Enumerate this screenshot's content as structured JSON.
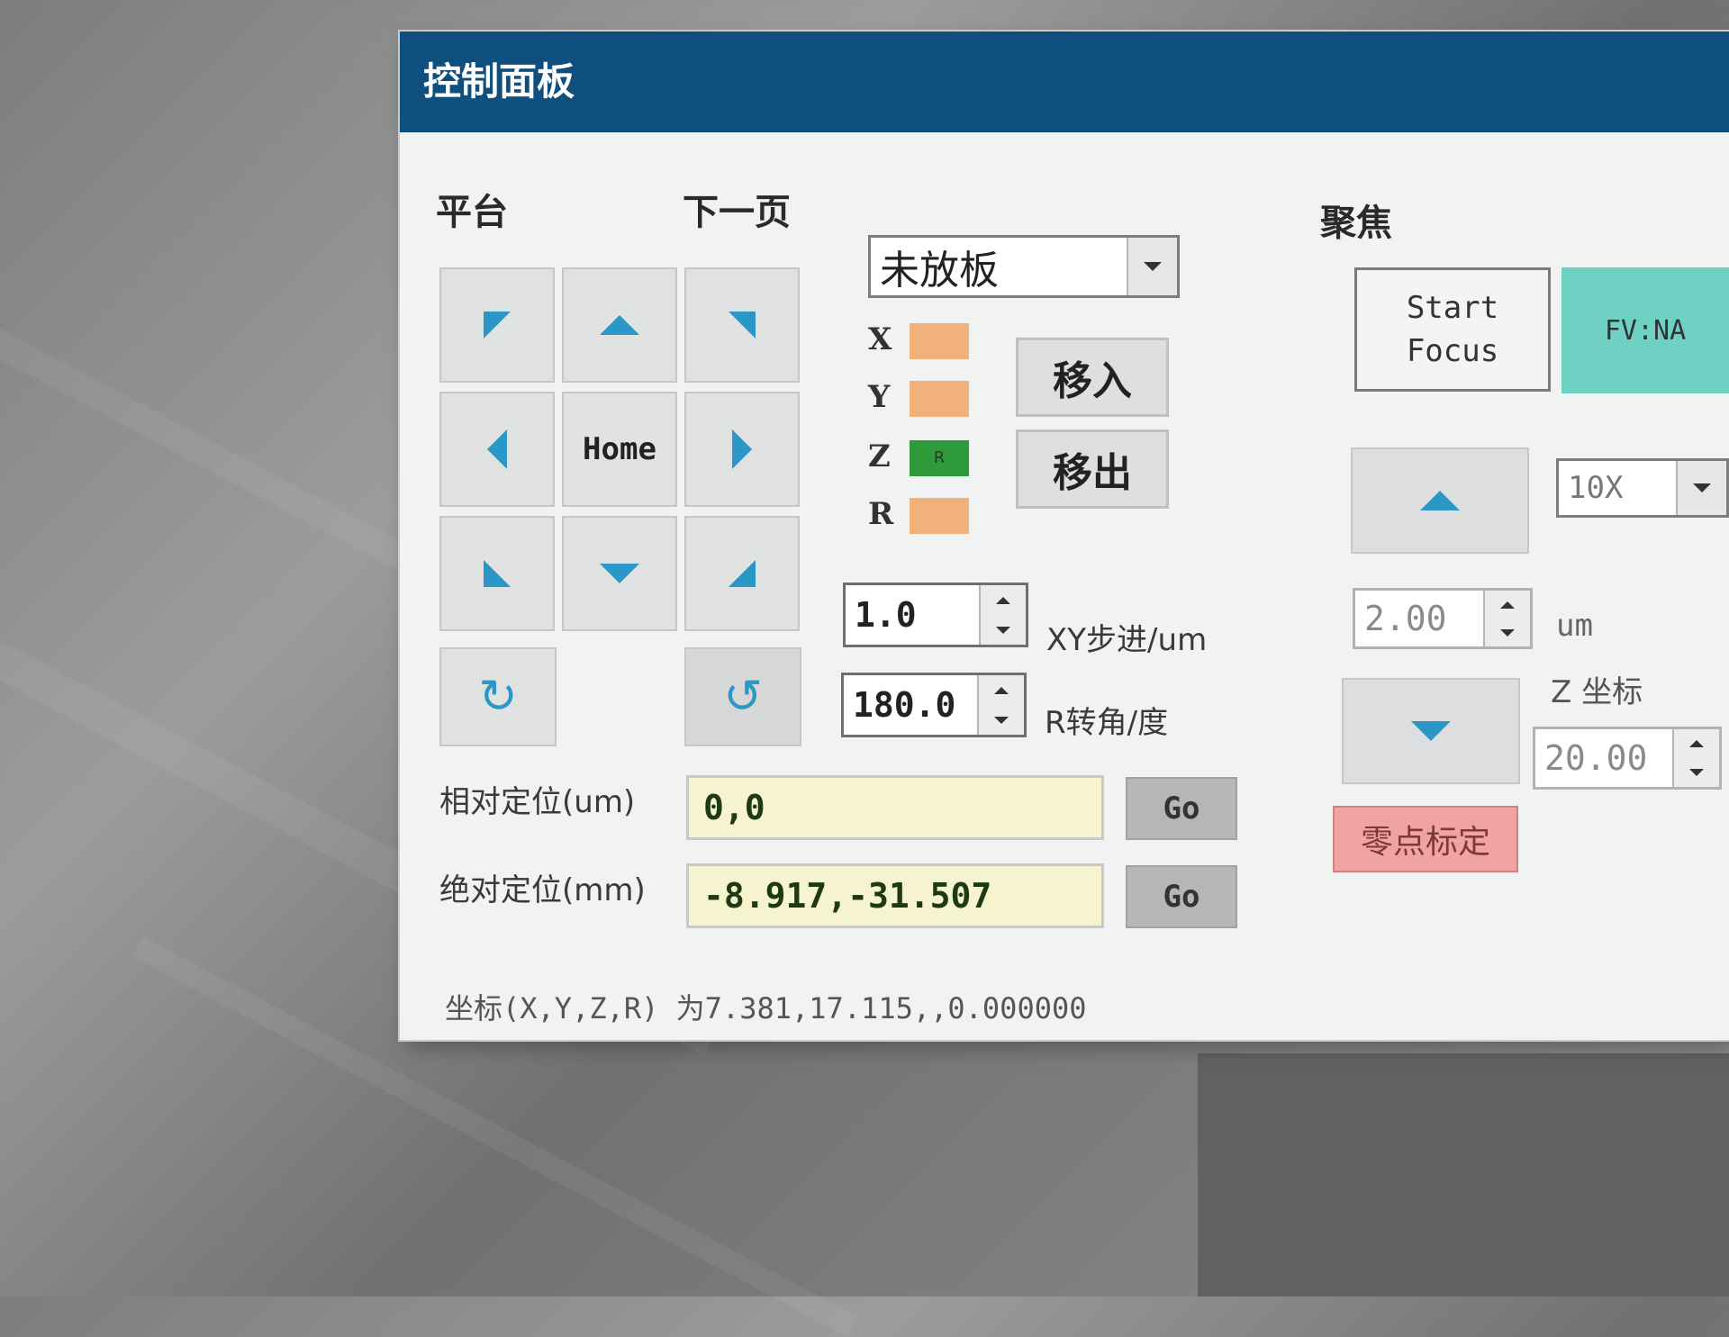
{
  "window": {
    "title": "控制面板"
  },
  "stage": {
    "label": "平台",
    "next_page": "下一页",
    "home_label": "Home"
  },
  "plate_select": {
    "value": "未放板"
  },
  "axes": [
    {
      "name": "X",
      "state": "",
      "color": "#f0b17a"
    },
    {
      "name": "Y",
      "state": "",
      "color": "#f0b17a"
    },
    {
      "name": "Z",
      "state": "R",
      "color": "#2e9a3a"
    },
    {
      "name": "R",
      "state": "",
      "color": "#f0b17a"
    }
  ],
  "load_buttons": {
    "move_in": "移入",
    "move_out": "移出"
  },
  "xy_step": {
    "value": "1.0",
    "label": "XY步进/um"
  },
  "r_angle": {
    "value": "180.0",
    "label": "R转角/度"
  },
  "relative": {
    "label": "相对定位(um)",
    "value": "0,0",
    "go": "Go"
  },
  "absolute": {
    "label": "绝对定位(mm)",
    "value": "-8.917,-31.507",
    "go": "Go"
  },
  "status_text": "坐标(X,Y,Z,R) 为7.381,17.115,,0.000000",
  "focus": {
    "label": "聚焦",
    "start_line1": "Start",
    "start_line2": "Focus",
    "fv": "FV:NA",
    "objective": "10X",
    "step_value": "2.00",
    "step_unit": "um",
    "z_label": "Z 坐标",
    "z_value": "20.00",
    "zero_btn": "零点标定"
  }
}
